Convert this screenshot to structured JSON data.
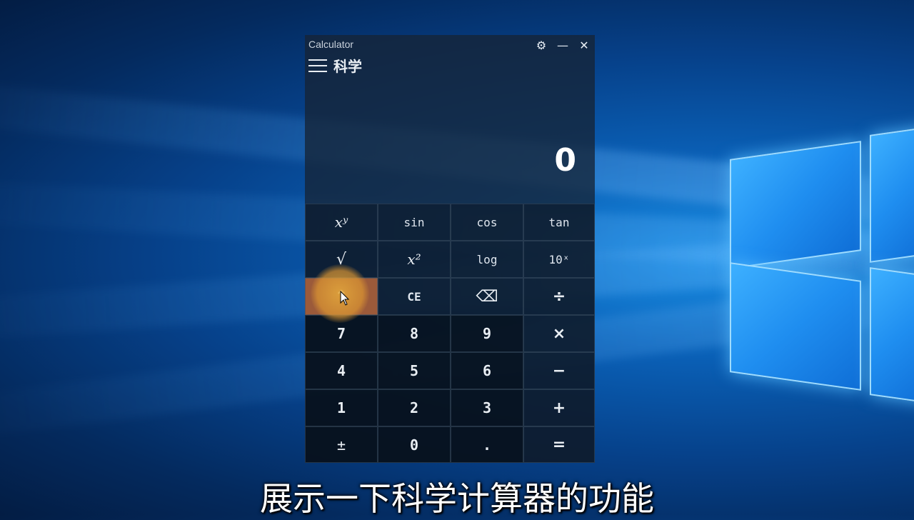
{
  "app": {
    "title": "Calculator",
    "mode": "科学"
  },
  "titlebar": {
    "settings_icon": "gear-icon",
    "minimize_icon": "minimize-icon",
    "close_icon": "close-icon"
  },
  "display": {
    "value": "0"
  },
  "keys": {
    "r1": [
      "xʸ",
      "sin",
      "cos",
      "tan"
    ],
    "r2": [
      "√",
      "x²",
      "log",
      "10ˣ"
    ],
    "r3": [
      "↑",
      "CE",
      "⌫",
      "÷"
    ],
    "r4": [
      "7",
      "8",
      "9",
      "×"
    ],
    "r5": [
      "4",
      "5",
      "6",
      "−"
    ],
    "r6": [
      "1",
      "2",
      "3",
      "+"
    ],
    "r7": [
      "±",
      "0",
      ".",
      "="
    ]
  },
  "subtitle": "展示一下科学计算器的功能",
  "colors": {
    "accent_hover": "#9b5a3a",
    "panel": "#162436"
  }
}
